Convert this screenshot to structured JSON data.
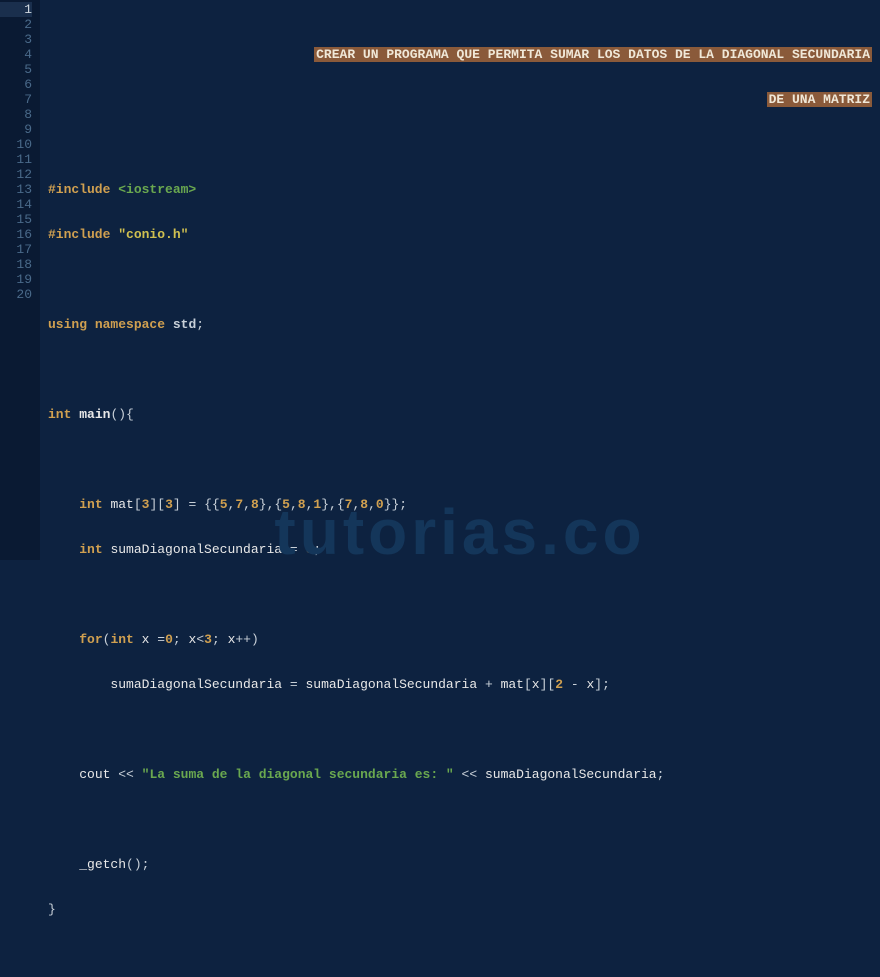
{
  "lineCount": 20,
  "currentLine": 1,
  "comment": {
    "line1": "CREAR UN PROGRAMA QUE PERMITA SUMAR LOS DATOS DE LA DIAGONAL SECUNDARIA",
    "line2": "DE UNA MATRIZ"
  },
  "code": {
    "include1_a": "#include ",
    "include1_b": "<iostream>",
    "include2_a": "#include ",
    "include2_b": "\"conio.h\"",
    "using": "using",
    "namespace": "namespace",
    "std": "std",
    "int": "int",
    "main": "main",
    "mat": "mat",
    "dim3a": "3",
    "dim3b": "3",
    "m00": "5",
    "m01": "7",
    "m02": "8",
    "m10": "5",
    "m11": "8",
    "m12": "1",
    "m20": "7",
    "m21": "8",
    "m22": "0",
    "sumaVar": "sumaDiagonalSecundaria",
    "zero": "0",
    "for": "for",
    "x": "x",
    "x0": "0",
    "three": "3",
    "two": "2",
    "cout": "cout",
    "str": "\"La suma de la diagonal secundaria es: \"",
    "getch": "_getch"
  },
  "watermark": "tutorias.co"
}
